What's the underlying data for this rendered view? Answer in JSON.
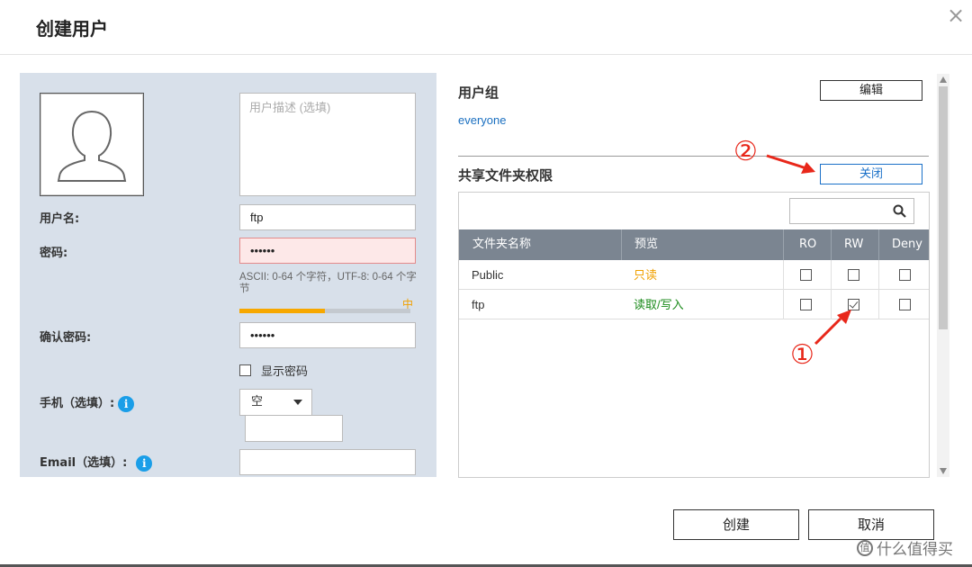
{
  "dialog": {
    "title": "创建用户",
    "close_glyph": "×"
  },
  "form": {
    "description_placeholder": "用户描述 (选填)",
    "username_label": "用户名:",
    "username_value": "ftp",
    "password_label": "密码:",
    "password_value": "••••••",
    "password_hint": "ASCII: 0-64 个字符，UTF-8: 0-64 个字节",
    "strength_label": "中",
    "strength_level": 0.5,
    "confirm_label": "确认密码:",
    "confirm_value": "••••••",
    "show_password_label": "显示密码",
    "phone_label": "手机（选填）:",
    "phone_select_value": "空",
    "email_label": "Email（选填）:",
    "info_glyph": "i"
  },
  "group": {
    "title": "用户组",
    "edit_label": "编辑",
    "value": "everyone"
  },
  "share": {
    "title": "共享文件夹权限",
    "close_label": "关闭",
    "columns": [
      "文件夹名称",
      "预览",
      "RO",
      "RW",
      "Deny"
    ],
    "rows": [
      {
        "name": "Public",
        "preview": "只读",
        "preview_color": "#f0a000",
        "ro": false,
        "rw": false,
        "deny": false
      },
      {
        "name": "ftp",
        "preview": "读取/写入",
        "preview_color": "#1a8a1a",
        "ro": false,
        "rw": true,
        "deny": false
      }
    ]
  },
  "footer": {
    "create_label": "创建",
    "cancel_label": "取消"
  },
  "annotations": {
    "one": "①",
    "two": "②"
  },
  "watermark": {
    "text": "什么值得买",
    "glyph": "值"
  },
  "colors": {
    "accent": "#1a70c8",
    "arrow": "#e8271a",
    "panel_bg": "#d8e0ea"
  }
}
